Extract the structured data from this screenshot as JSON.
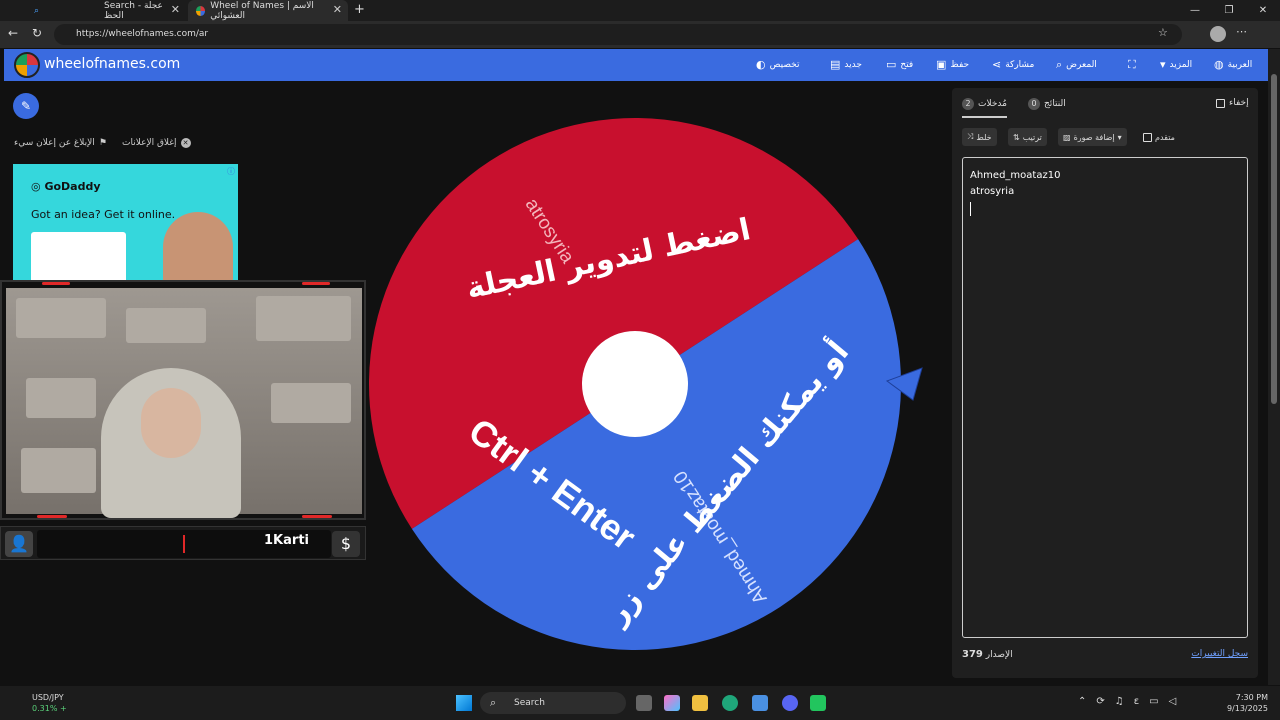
{
  "browser": {
    "tabs": [
      {
        "label": "Search - عجلة الحظ"
      },
      {
        "label": "Wheel of Names | الاسم العشوائي"
      }
    ],
    "url": "https://wheelofnames.com/ar"
  },
  "site": {
    "title": "wheelofnames.com",
    "nav": {
      "language": "العربية",
      "more": "المزيد",
      "gallery": "المعرض",
      "share": "مشاركة",
      "save": "حفظ",
      "open": "فتح",
      "new": "جديد",
      "customize": "تخصيص"
    }
  },
  "ad": {
    "close_label": "إغلاق الإعلانات",
    "report_label": "الإبلاغ عن إعلان سيء",
    "brand": "GoDaddy",
    "text": "Got an idea? Get it online."
  },
  "stream": {
    "name": "1Karti"
  },
  "wheel": {
    "segments": [
      {
        "name": "atrosyria",
        "color": "#c8102e"
      },
      {
        "name": "Ahmed_moataz10",
        "color": "#3a6be0"
      }
    ],
    "instruction_top": "اضغط لتدوير العجلة",
    "instruction_bottom": "أو يمكنك الضغط على زر",
    "shortcut": "Ctrl + Enter"
  },
  "panel": {
    "tab_entries": "مُدخلات",
    "entries_count": "2",
    "tab_results": "النتائج",
    "results_count": "0",
    "hide_label": "إخفاء",
    "shuffle_label": "خلط",
    "sort_label": "ترتيب",
    "add_image_label": "إضافة صورة",
    "advanced_label": "متقدم",
    "entries": [
      "Ahmed_moataz10",
      "atrosyria"
    ],
    "version_label": "الإصدار",
    "version": "379",
    "changelog_label": "سجل التغييرات"
  },
  "taskbar": {
    "ticker_symbol": "USD/JPY",
    "ticker_change": "0.31% +",
    "search": "Search",
    "time": "7:30 PM",
    "date": "9/13/2025"
  }
}
